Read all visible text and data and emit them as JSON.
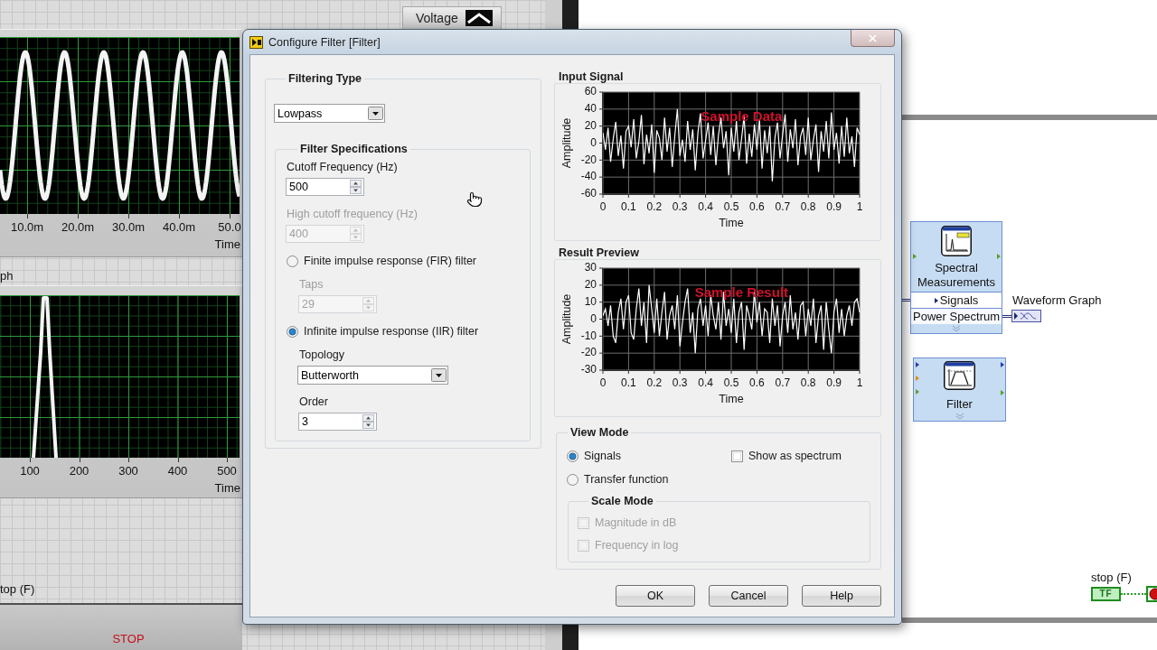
{
  "front_panel": {
    "plot_legend": {
      "label": "Voltage"
    },
    "graphs": [
      {
        "kind": "sine",
        "x_ticks": [
          "10.0m",
          "20.0m",
          "30.0m",
          "40.0m",
          "50.0"
        ],
        "x_axis_label": "Time"
      },
      {
        "kind": "peak",
        "label": "ph",
        "x_ticks": [
          "100",
          "200",
          "300",
          "400",
          "500"
        ],
        "x_axis_label": "Time"
      }
    ],
    "stop_control": {
      "label": "top (F)",
      "button_text": "STOP"
    }
  },
  "dialog": {
    "title": "Configure Filter [Filter]",
    "filtering_type": {
      "title": "Filtering Type",
      "value": "Lowpass"
    },
    "filter_specifications": {
      "title": "Filter Specifications",
      "fields": [
        {
          "label": "Cutoff Frequency (Hz)",
          "value": "500",
          "disabled": false
        },
        {
          "label": "High cutoff frequency (Hz)",
          "value": "400",
          "disabled": true
        }
      ],
      "filter_options": [
        {
          "label": "Finite impulse response (FIR) filter",
          "selected": false,
          "children": [
            {
              "kind": "numeric",
              "label": "Taps",
              "value": "29",
              "disabled": true
            }
          ]
        },
        {
          "label": "Infinite impulse response (IIR) filter",
          "selected": true,
          "children": [
            {
              "kind": "dropdown",
              "label": "Topology",
              "value": "Butterworth",
              "disabled": false
            },
            {
              "kind": "numeric",
              "label": "Order",
              "value": "3",
              "disabled": false
            }
          ]
        }
      ]
    },
    "input_signal": {
      "title": "Input Signal",
      "chart_data": {
        "type": "line",
        "xlabel": "Time",
        "ylabel": "Amplitude",
        "grid": true,
        "xlim": [
          0,
          1
        ],
        "ylim": [
          -60,
          60
        ],
        "xticks": [
          0,
          0.1,
          0.2,
          0.3,
          0.4,
          0.5,
          0.6,
          0.7,
          0.8,
          0.9,
          1
        ],
        "yticks": [
          -60,
          -40,
          -20,
          0,
          20,
          40,
          60
        ],
        "x": [
          0,
          0.01,
          0.02,
          0.03,
          0.04,
          0.05,
          0.06,
          0.07,
          0.08,
          0.09,
          0.1,
          0.11,
          0.12,
          0.13,
          0.14,
          0.15,
          0.16,
          0.17,
          0.18,
          0.19,
          0.2,
          0.21,
          0.22,
          0.23,
          0.24,
          0.25,
          0.26,
          0.27,
          0.28,
          0.29,
          0.3,
          0.31,
          0.32,
          0.33,
          0.34,
          0.35,
          0.36,
          0.37,
          0.38,
          0.39,
          0.4,
          0.41,
          0.42,
          0.43,
          0.44,
          0.45,
          0.46,
          0.47,
          0.48,
          0.49,
          0.5,
          0.51,
          0.52,
          0.53,
          0.54,
          0.55,
          0.56,
          0.57,
          0.58,
          0.59,
          0.6,
          0.61,
          0.62,
          0.63,
          0.64,
          0.65,
          0.66,
          0.67,
          0.68,
          0.69,
          0.7,
          0.71,
          0.72,
          0.73,
          0.74,
          0.75,
          0.76,
          0.77,
          0.78,
          0.79,
          0.8,
          0.81,
          0.82,
          0.83,
          0.84,
          0.85,
          0.86,
          0.87,
          0.88,
          0.89,
          0.9,
          0.91,
          0.92,
          0.93,
          0.94,
          0.95,
          0.96,
          0.97,
          0.98,
          0.99,
          1
        ],
        "series": [
          {
            "color": "#ffffff",
            "values": [
              12,
              -8,
              18,
              -22,
              5,
              25,
              -15,
              9,
              -30,
              14,
              20,
              -5,
              28,
              -18,
              2,
              33,
              -25,
              10,
              -12,
              22,
              -35,
              15,
              6,
              -20,
              30,
              -10,
              18,
              -28,
              8,
              40,
              -15,
              4,
              -22,
              26,
              -8,
              16,
              -32,
              12,
              35,
              -18,
              3,
              24,
              -14,
              20,
              -26,
              9,
              30,
              -6,
              14,
              -38,
              18,
              -10,
              26,
              -20,
              5,
              32,
              -24,
              11,
              -16,
              22,
              -8,
              28,
              -30,
              15,
              -12,
              20,
              -45,
              6,
              24,
              -18,
              10,
              34,
              -22,
              16,
              -6,
              28,
              -26,
              8,
              18,
              -14,
              30,
              -20,
              4,
              22,
              -34,
              14,
              -10,
              26,
              -18,
              36,
              -8,
              12,
              -24,
              20,
              -16,
              30,
              -12,
              8,
              -28,
              18,
              10
            ]
          }
        ],
        "annotations": [
          "Sample Data"
        ]
      }
    },
    "result_preview": {
      "title": "Result Preview",
      "chart_data": {
        "type": "line",
        "xlabel": "Time",
        "ylabel": "Amplitude",
        "grid": true,
        "xlim": [
          0,
          1
        ],
        "ylim": [
          -30,
          30
        ],
        "xticks": [
          0,
          0.1,
          0.2,
          0.3,
          0.4,
          0.5,
          0.6,
          0.7,
          0.8,
          0.9,
          1
        ],
        "yticks": [
          -30,
          -20,
          -10,
          0,
          10,
          20,
          30
        ],
        "x": [
          0,
          0.01,
          0.02,
          0.03,
          0.04,
          0.05,
          0.06,
          0.07,
          0.08,
          0.09,
          0.1,
          0.11,
          0.12,
          0.13,
          0.14,
          0.15,
          0.16,
          0.17,
          0.18,
          0.19,
          0.2,
          0.21,
          0.22,
          0.23,
          0.24,
          0.25,
          0.26,
          0.27,
          0.28,
          0.29,
          0.3,
          0.31,
          0.32,
          0.33,
          0.34,
          0.35,
          0.36,
          0.37,
          0.38,
          0.39,
          0.4,
          0.41,
          0.42,
          0.43,
          0.44,
          0.45,
          0.46,
          0.47,
          0.48,
          0.49,
          0.5,
          0.51,
          0.52,
          0.53,
          0.54,
          0.55,
          0.56,
          0.57,
          0.58,
          0.59,
          0.6,
          0.61,
          0.62,
          0.63,
          0.64,
          0.65,
          0.66,
          0.67,
          0.68,
          0.69,
          0.7,
          0.71,
          0.72,
          0.73,
          0.74,
          0.75,
          0.76,
          0.77,
          0.78,
          0.79,
          0.8,
          0.81,
          0.82,
          0.83,
          0.84,
          0.85,
          0.86,
          0.87,
          0.88,
          0.89,
          0.9,
          0.91,
          0.92,
          0.93,
          0.94,
          0.95,
          0.96,
          0.97,
          0.98,
          0.99,
          1
        ],
        "series": [
          {
            "color": "#ffffff",
            "values": [
              2,
              6,
              -4,
              8,
              -10,
              -14,
              4,
              12,
              -6,
              10,
              14,
              -8,
              -12,
              6,
              18,
              -4,
              10,
              -14,
              20,
              6,
              -8,
              12,
              -10,
              4,
              16,
              -12,
              2,
              8,
              -6,
              14,
              -16,
              -2,
              10,
              18,
              -8,
              4,
              -20,
              6,
              12,
              -4,
              8,
              -10,
              14,
              2,
              -6,
              10,
              -12,
              16,
              -4,
              6,
              -8,
              12,
              -14,
              4,
              10,
              -18,
              8,
              2,
              -6,
              16,
              -2,
              10,
              -10,
              6,
              4,
              -14,
              12,
              -4,
              8,
              -16,
              2,
              10,
              -8,
              14,
              -6,
              4,
              -12,
              8,
              10,
              -10,
              6,
              -4,
              12,
              -14,
              2,
              8,
              -18,
              10,
              -6,
              -20,
              4,
              12,
              -8,
              6,
              -10,
              2,
              8,
              -4,
              10,
              12,
              4
            ]
          }
        ],
        "annotations": [
          "Sample Result"
        ]
      }
    },
    "view_mode": {
      "title": "View Mode",
      "options": [
        {
          "label": "Signals",
          "selected": true
        },
        {
          "label": "Transfer function",
          "selected": false
        }
      ],
      "show_as_spectrum": {
        "label": "Show as spectrum",
        "checked": false
      },
      "scale_mode": {
        "title": "Scale Mode",
        "options": [
          {
            "label": "Magnitude in dB",
            "checked": false,
            "disabled": true
          },
          {
            "label": "Frequency in log",
            "checked": false,
            "disabled": true
          }
        ]
      }
    },
    "buttons": [
      "OK",
      "Cancel",
      "Help"
    ]
  },
  "block_diagram": {
    "nodes": [
      {
        "kind": "spectral",
        "title": "Spectral Measurements",
        "terminals": [
          {
            "kind": "input",
            "label": "Signals"
          },
          {
            "kind": "output",
            "label": "Power Spectrum"
          }
        ]
      },
      {
        "kind": "filter",
        "title": "Filter"
      }
    ],
    "graph_indicator": {
      "label": "Waveform Graph"
    },
    "stop_terminal": {
      "label": "stop (F)",
      "value": "TF"
    }
  }
}
